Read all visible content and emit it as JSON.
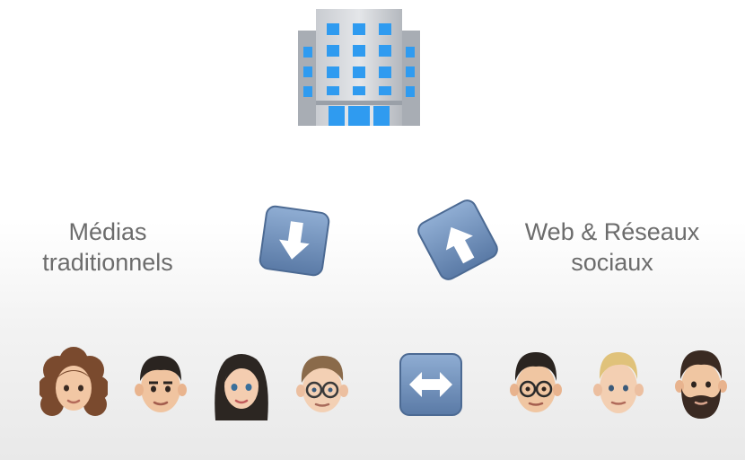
{
  "left_label": {
    "line1": "Médias",
    "line2": "traditionnels"
  },
  "right_label": {
    "line1": "Web & Réseaux",
    "line2": "sociaux"
  },
  "icons": {
    "top": "office-building-icon",
    "left_arrow": "down-arrow-icon",
    "right_arrow": "up-arrow-icon",
    "middle_arrow": "left-right-arrow-icon"
  },
  "people": [
    "woman-curly-hair-avatar",
    "man-dark-hair-avatar",
    "woman-long-dark-hair-avatar",
    "man-glasses-avatar",
    "man-glasses-dark-hair-avatar",
    "man-blond-avatar",
    "man-beard-avatar"
  ],
  "colors": {
    "text": "#6c6c6c",
    "arrow_blue": "#6b8cb6",
    "building_gray": "#b8bcc2",
    "window_blue": "#2f9bf0"
  }
}
